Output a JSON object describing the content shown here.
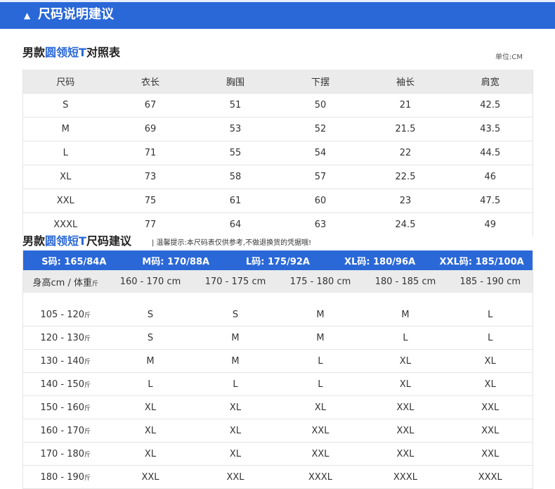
{
  "banner": {
    "icon": "triangle-up-icon",
    "title": "尺码说明建议"
  },
  "section1": {
    "title_pre": "男款",
    "title_hl": "圆领短T",
    "title_post": "对照表",
    "unit": "单位:CM",
    "headers": [
      "尺码",
      "衣长",
      "胸围",
      "下摆",
      "袖长",
      "肩宽"
    ],
    "rows": [
      [
        "S",
        "67",
        "51",
        "50",
        "21",
        "42.5"
      ],
      [
        "M",
        "69",
        "53",
        "52",
        "21.5",
        "43.5"
      ],
      [
        "L",
        "71",
        "55",
        "54",
        "22",
        "44.5"
      ],
      [
        "XL",
        "73",
        "58",
        "57",
        "22.5",
        "46"
      ],
      [
        "XXL",
        "75",
        "61",
        "60",
        "23",
        "47.5"
      ],
      [
        "XXXL",
        "77",
        "64",
        "63",
        "24.5",
        "49"
      ]
    ]
  },
  "section2": {
    "title_pre": "男款",
    "title_hl": "圆领短T",
    "title_post": "尺码建议",
    "hint": "| 温馨提示:本尺码表仅供参考,不做退换货的凭据哦!",
    "size_codes": [
      "S码: 165/84A",
      "M码: 170/88A",
      "L码: 175/92A",
      "XL码: 180/96A",
      "XXL码: 185/100A"
    ],
    "corner": [
      "身高cm / 体重",
      "斤"
    ],
    "heights": [
      "160 - 170 cm",
      "170 - 175 cm",
      "175 - 180 cm",
      "180 - 185 cm",
      "185 - 190 cm"
    ],
    "jin": "斤",
    "rows": [
      {
        "weight": "105 - 120",
        "sizes": [
          "S",
          "S",
          "M",
          "M",
          "L"
        ]
      },
      {
        "weight": "120 - 130",
        "sizes": [
          "S",
          "M",
          "M",
          "L",
          "L"
        ]
      },
      {
        "weight": "130 - 140",
        "sizes": [
          "M",
          "M",
          "L",
          "XL",
          "XL"
        ]
      },
      {
        "weight": "140 - 150",
        "sizes": [
          "L",
          "L",
          "L",
          "XL",
          "XL"
        ]
      },
      {
        "weight": "150 - 160",
        "sizes": [
          "XL",
          "XL",
          "XL",
          "XXL",
          "XXL"
        ]
      },
      {
        "weight": "160 - 170",
        "sizes": [
          "XL",
          "XL",
          "XXL",
          "XXL",
          "XXL"
        ]
      },
      {
        "weight": "170 - 180",
        "sizes": [
          "XL",
          "XL",
          "XXL",
          "XXL",
          "XXL"
        ]
      },
      {
        "weight": "180 - 190",
        "sizes": [
          "XXL",
          "XXL",
          "XXXL",
          "XXXL",
          "XXXL"
        ]
      }
    ]
  },
  "colors": {
    "accent": "#2a68d8",
    "header_gray": "#ebebeb"
  }
}
